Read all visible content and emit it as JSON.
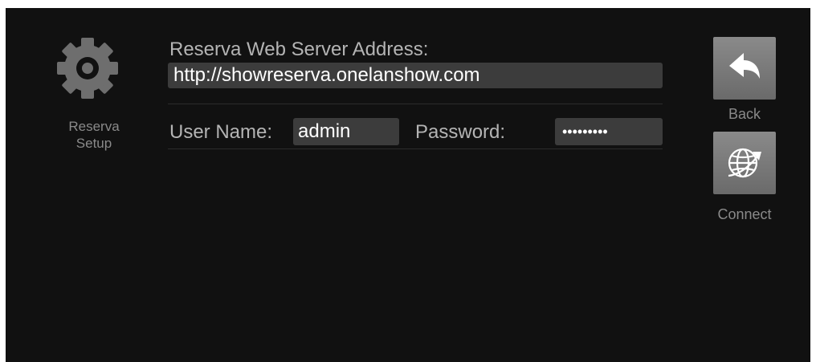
{
  "sidebar": {
    "icon": "gear-icon",
    "label_line1": "Reserva",
    "label_line2": "Setup"
  },
  "form": {
    "address_label": "Reserva Web Server Address:",
    "address_value": "http://showreserva.onelanshow.com",
    "username_label": "User Name:",
    "username_value": "admin",
    "password_label": "Password:",
    "password_value": "•••••••••"
  },
  "buttons": {
    "back_label": "Back",
    "back_icon": "back-arrow-icon",
    "connect_label": "Connect",
    "connect_icon": "globe-icon"
  },
  "colors": {
    "background": "#111111",
    "field": "#3c3c3c",
    "label": "#b4b4b4",
    "button": "#7a7a7a"
  }
}
